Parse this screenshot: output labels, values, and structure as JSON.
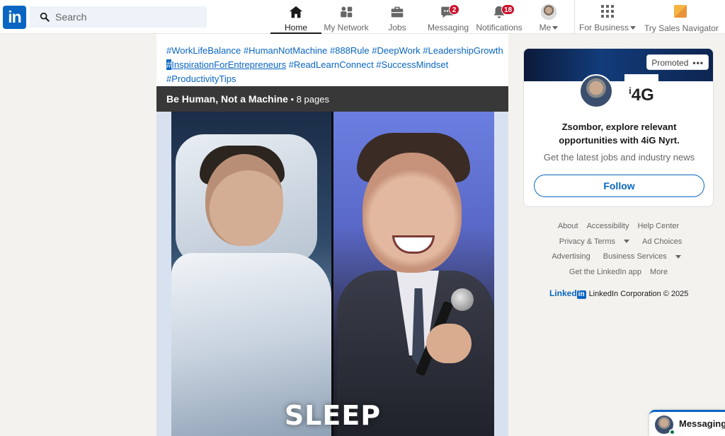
{
  "nav": {
    "logo_text": "in",
    "search_placeholder": "Search",
    "items": [
      {
        "label": "Home",
        "icon": "home-icon",
        "active": true
      },
      {
        "label": "My Network",
        "icon": "network-icon"
      },
      {
        "label": "Jobs",
        "icon": "jobs-icon"
      },
      {
        "label": "Messaging",
        "icon": "messaging-icon",
        "badge": "2"
      },
      {
        "label": "Notifications",
        "icon": "notifications-icon",
        "badge": "18"
      },
      {
        "label": "Me",
        "icon": "avatar"
      },
      {
        "label": "For Business",
        "icon": "grid-icon"
      },
      {
        "label": "Try Sales Navigator",
        "icon": "sales-navigator-icon"
      }
    ]
  },
  "post": {
    "hashtags_line1": "#WorkLifeBalance #HumanNotMachine #888Rule #DeepWork #LeadershipGrowth",
    "hashtag_selected_char": "#",
    "hashtag_underlined": "InspirationForEntrepreneurs",
    "hashtags_line2_rest": " #ReadLearnConnect #SuccessMindset",
    "hashtags_line3": "#ProductivityTips",
    "document_title": "Be Human, Not a Machine",
    "document_pages": " • 8 pages",
    "slide_caption": "SLEEP"
  },
  "ad": {
    "promoted_label": "Promoted",
    "more_dots": "•••",
    "company_logo_text": "4G",
    "title": "Zsombor, explore relevant opportunities with 4iG Nyrt.",
    "subtitle": "Get the latest jobs and industry news",
    "button_label": "Follow"
  },
  "footer": {
    "links_row1": [
      "About",
      "Accessibility",
      "Help Center"
    ],
    "links_row2": [
      "Privacy & Terms",
      "Ad Choices"
    ],
    "links_row3": [
      "Advertising",
      "Business Services"
    ],
    "links_row4": [
      "Get the LinkedIn app",
      "More"
    ],
    "brand_word": "Linked",
    "brand_in": "in",
    "copyright": "LinkedIn Corporation © 2025"
  },
  "messaging_dock": {
    "label": "Messaging"
  },
  "colors": {
    "brand_blue": "#0a66c2",
    "badge_red": "#cb112d",
    "page_bg": "#f4f2ee"
  }
}
